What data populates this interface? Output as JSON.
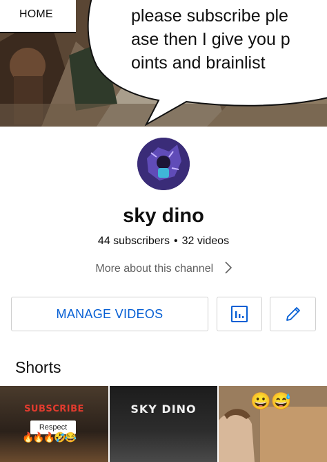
{
  "banner": {
    "tab_label": "HOME",
    "speech_bubble_text": "please subscribe ple\nase then I give you p\noints and brainlist"
  },
  "channel": {
    "name": "sky dino",
    "subscribers": "44 subscribers",
    "separator": "•",
    "videos": "32 videos",
    "more_about": "More about this channel"
  },
  "actions": {
    "manage_label": "MANAGE VIDEOS",
    "analytics_icon": "analytics-icon",
    "edit_icon": "pencil-icon"
  },
  "shorts": {
    "title": "Shorts",
    "items": [
      {
        "overlay_text": "SUBSCRIBE",
        "caption": "Respect",
        "emojis": "🔥🔥🔥🤣😂"
      },
      {
        "overlay_text": "SKY DINO"
      },
      {
        "emojis": "😀😅"
      }
    ]
  },
  "colors": {
    "accent_blue": "#065fd4",
    "text_primary": "#0f0f0f",
    "text_secondary": "#606060",
    "border": "#cfcfcf"
  }
}
